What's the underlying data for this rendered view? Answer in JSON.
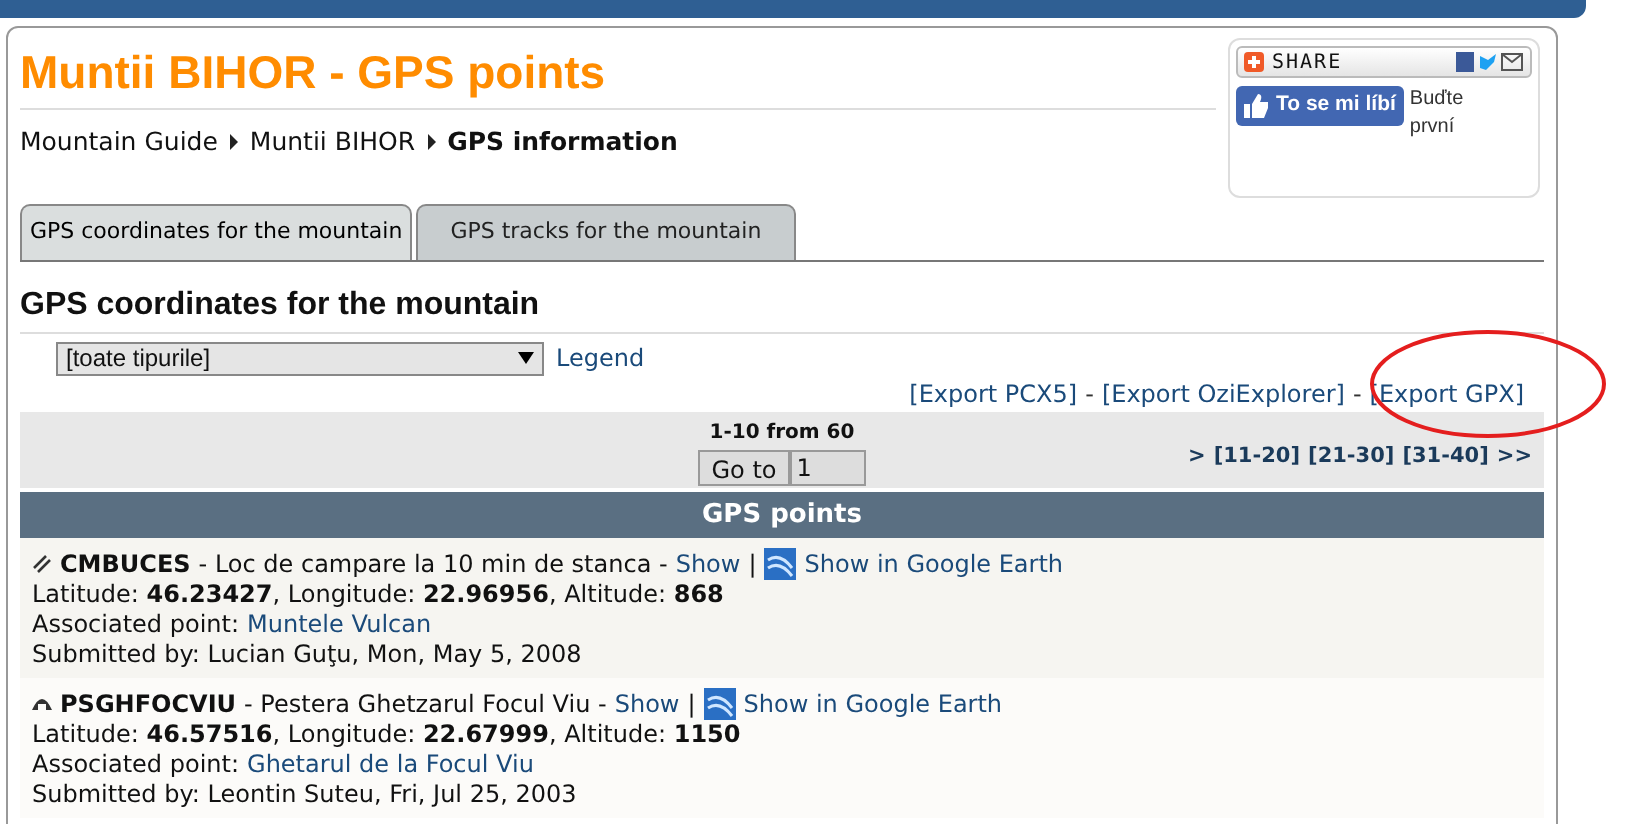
{
  "page_title": "Muntii BIHOR - GPS points",
  "breadcrumb": [
    {
      "label": "Mountain Guide",
      "current": false
    },
    {
      "label": "Muntii BIHOR",
      "current": false
    },
    {
      "label": "GPS information",
      "current": true
    }
  ],
  "share": {
    "label": "SHARE",
    "like_button": "To se mi líbí",
    "like_note": "Buďte první"
  },
  "tabs": [
    {
      "label": "GPS coordinates for the mountain",
      "selected": true
    },
    {
      "label": "GPS tracks for the mountain",
      "selected": false
    }
  ],
  "section_title": "GPS coordinates for the mountain",
  "type_filter": {
    "value": "[toate tipurile]",
    "legend": "Legend"
  },
  "exports": [
    {
      "label": "[Export PCX5]",
      "circled": false
    },
    {
      "label": "-",
      "circled": false
    },
    {
      "label": "[Export OziExplorer]",
      "circled": false
    },
    {
      "label": "-",
      "circled": false
    },
    {
      "label": "[Export GPX]",
      "circled": true
    }
  ],
  "pager": {
    "range": "1-10 from 60",
    "go_button": "Go to",
    "page_value": "1",
    "links": [
      ">",
      "[11-20]",
      "[21-30]",
      "[31-40]",
      ">>"
    ]
  },
  "list_header": "GPS points",
  "points": [
    {
      "kind": "camp",
      "code": "CMBUCES",
      "description": "- Loc de campare la 10 min de stanca -",
      "show": "Show",
      "separator": "|",
      "earth": "Show in Google Earth",
      "coordinates": "Latitude: **46.23427**, Longitude: **22.96956**, Altitude: **868**",
      "associated_label": "Associated point:",
      "associated": "Muntele Vulcan",
      "submitted": "Submitted by: Lucian Guţu, Mon, May 5, 2008"
    },
    {
      "kind": "cave",
      "code": "PSGHFOCVIU",
      "description": "- Pestera Ghetzarul Focul Viu -",
      "show": "Show",
      "separator": "|",
      "earth": "Show in Google Earth",
      "coordinates": "Latitude: **46.57516**, Longitude: **22.67999**, Altitude: **1150**",
      "associated_label": "Associated point:",
      "associated": "Ghetarul de la Focul Viu",
      "submitted": "Submitted by: Leontin Suteu, Fri, Jul 25, 2003"
    }
  ]
}
